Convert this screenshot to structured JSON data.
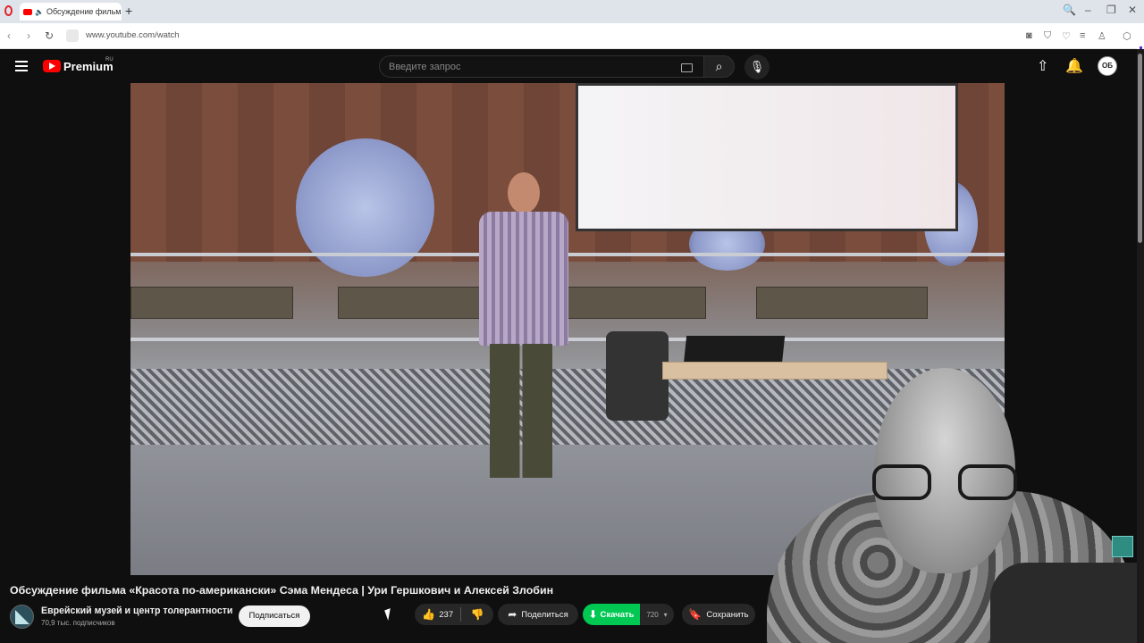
{
  "browser": {
    "tab_title": "Обсуждение фильма",
    "new_tab_icon": "+",
    "url": "www.youtube.com/watch"
  },
  "header": {
    "brand": "Premium",
    "region": "RU",
    "search_placeholder": "Введите запрос",
    "avatar_initials": "ОБ"
  },
  "video": {
    "title": "Обсуждение фильма «Красота по-американски» Сэма Мендеса | Ури Гершкович и Алексей Злобин"
  },
  "channel": {
    "name": "Еврейский музей и центр толерантности",
    "subscribers": "70,9 тыс. подписчиков",
    "subscribe_label": "Подписаться"
  },
  "actions": {
    "like_count": "237",
    "share_label": "Поделиться",
    "download_label": "Скачать",
    "download_quality": "720",
    "save_label": "Сохранить"
  },
  "colors": {
    "download_accent": "#00c853",
    "youtube_red": "#ff0000",
    "background": "#0f0f0f"
  }
}
